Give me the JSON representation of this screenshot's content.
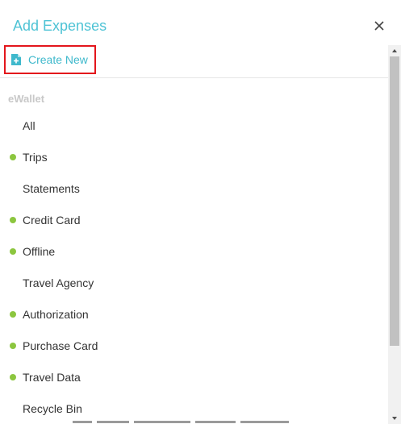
{
  "header": {
    "title": "Add Expenses",
    "close_icon": "close-icon"
  },
  "create_new": {
    "label": "Create New",
    "icon": "document-add-icon"
  },
  "section": {
    "title": "eWallet"
  },
  "items": [
    {
      "label": "All",
      "dot": false
    },
    {
      "label": "Trips",
      "dot": true
    },
    {
      "label": "Statements",
      "dot": false
    },
    {
      "label": "Credit Card",
      "dot": true
    },
    {
      "label": "Offline",
      "dot": true
    },
    {
      "label": "Travel Agency",
      "dot": false
    },
    {
      "label": "Authorization",
      "dot": true
    },
    {
      "label": "Purchase Card",
      "dot": true
    },
    {
      "label": "Travel Data",
      "dot": true
    },
    {
      "label": "Recycle Bin",
      "dot": false
    }
  ],
  "colors": {
    "accent": "#4ec3d5",
    "dot": "#8cc63f",
    "highlight_border": "#e3161c"
  }
}
